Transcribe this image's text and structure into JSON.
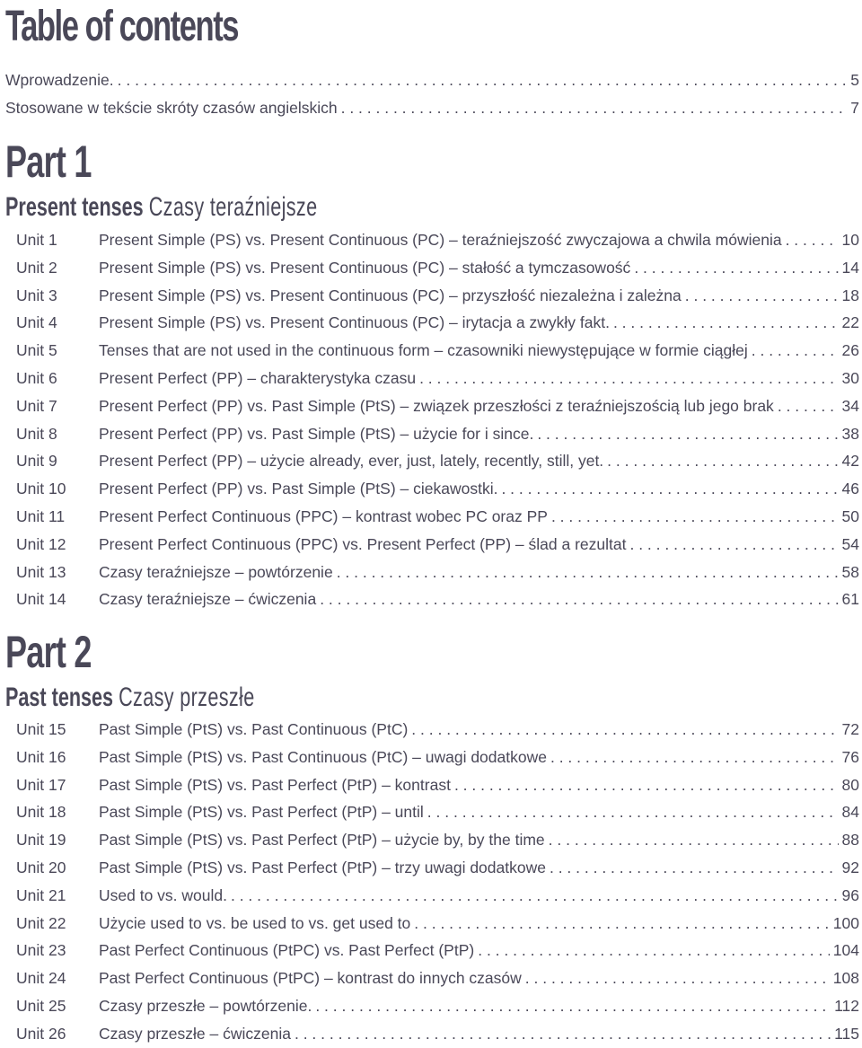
{
  "title": "Table of contents",
  "intro": [
    {
      "text": "Wprowadzenie.",
      "page": "5"
    },
    {
      "text": "Stosowane w tekście skróty czasów angielskich",
      "page": "7"
    }
  ],
  "parts": [
    {
      "title": "Part 1",
      "subtitle_en": "Present tenses",
      "subtitle_pl": "Czasy teraźniejsze",
      "units": [
        {
          "unit": "Unit 1",
          "text": "Present Simple (PS) vs. Present Continuous (PC) – teraźniejszość zwyczajowa a chwila mówienia",
          "page": "10"
        },
        {
          "unit": "Unit 2",
          "text": "Present Simple (PS) vs. Present Continuous (PC) – stałość a tymczasowość",
          "page": "14"
        },
        {
          "unit": "Unit 3",
          "text": "Present Simple (PS) vs. Present Continuous (PC) – przyszłość niezależna i zależna",
          "page": "18"
        },
        {
          "unit": "Unit 4",
          "text": "Present Simple (PS) vs. Present Continuous (PC) – irytacja a zwykły fakt.",
          "page": "22"
        },
        {
          "unit": "Unit 5",
          "text": "Tenses that are not used in the continuous form – czasowniki niewystępujące w formie ciągłej",
          "page": "26"
        },
        {
          "unit": "Unit 6",
          "text": "Present Perfect (PP) – charakterystyka czasu",
          "page": "30"
        },
        {
          "unit": "Unit 7",
          "text": "Present Perfect (PP) vs. Past Simple (PtS) – związek przeszłości z teraźniejszością lub jego brak",
          "page": "34"
        },
        {
          "unit": "Unit 8",
          "text": "Present Perfect (PP) vs. Past Simple (PtS) – użycie for i since.",
          "page": "38"
        },
        {
          "unit": "Unit 9",
          "text": "Present Perfect (PP) – użycie already, ever, just, lately, recently, still, yet.",
          "page": "42"
        },
        {
          "unit": "Unit 10",
          "text": "Present Perfect (PP) vs. Past Simple (PtS) – ciekawostki.",
          "page": "46"
        },
        {
          "unit": "Unit 11",
          "text": "Present Perfect Continuous (PPC) – kontrast wobec PC oraz PP",
          "page": "50"
        },
        {
          "unit": "Unit 12",
          "text": "Present Perfect Continuous (PPC) vs. Present Perfect (PP) – ślad a rezultat",
          "page": "54"
        },
        {
          "unit": "Unit 13",
          "text": "Czasy teraźniejsze – powtórzenie",
          "page": "58"
        },
        {
          "unit": "Unit 14",
          "text": "Czasy teraźniejsze – ćwiczenia",
          "page": "61"
        }
      ]
    },
    {
      "title": "Part 2",
      "subtitle_en": "Past tenses",
      "subtitle_pl": "Czasy przeszłe",
      "units": [
        {
          "unit": "Unit 15",
          "text": "Past Simple (PtS) vs. Past Continuous (PtC)",
          "page": "72"
        },
        {
          "unit": "Unit 16",
          "text": "Past Simple (PtS) vs. Past Continuous (PtC) – uwagi dodatkowe",
          "page": "76"
        },
        {
          "unit": "Unit 17",
          "text": "Past Simple (PtS) vs. Past Perfect (PtP) – kontrast",
          "page": "80"
        },
        {
          "unit": "Unit 18",
          "text": "Past Simple (PtS) vs. Past Perfect (PtP) – until",
          "page": "84"
        },
        {
          "unit": "Unit 19",
          "text": "Past Simple (PtS) vs. Past Perfect (PtP) – użycie by, by the time",
          "page": "88"
        },
        {
          "unit": "Unit 20",
          "text": "Past Simple (PtS) vs. Past Perfect (PtP) – trzy uwagi dodatkowe",
          "page": "92"
        },
        {
          "unit": "Unit 21",
          "text": "Used to vs. would.",
          "page": "96"
        },
        {
          "unit": "Unit 22",
          "text": "Użycie used to vs. be used to vs. get used to",
          "page": "100"
        },
        {
          "unit": "Unit 23",
          "text": "Past Perfect Continuous (PtPC) vs. Past Perfect (PtP)",
          "page": "104"
        },
        {
          "unit": "Unit 24",
          "text": "Past Perfect Continuous (PtPC) – kontrast do innych czasów",
          "page": "108"
        },
        {
          "unit": "Unit 25",
          "text": "Czasy przeszłe – powtórzenie.",
          "page": "112"
        },
        {
          "unit": "Unit 26",
          "text": "Czasy przeszłe – ćwiczenia",
          "page": "115"
        }
      ]
    }
  ]
}
